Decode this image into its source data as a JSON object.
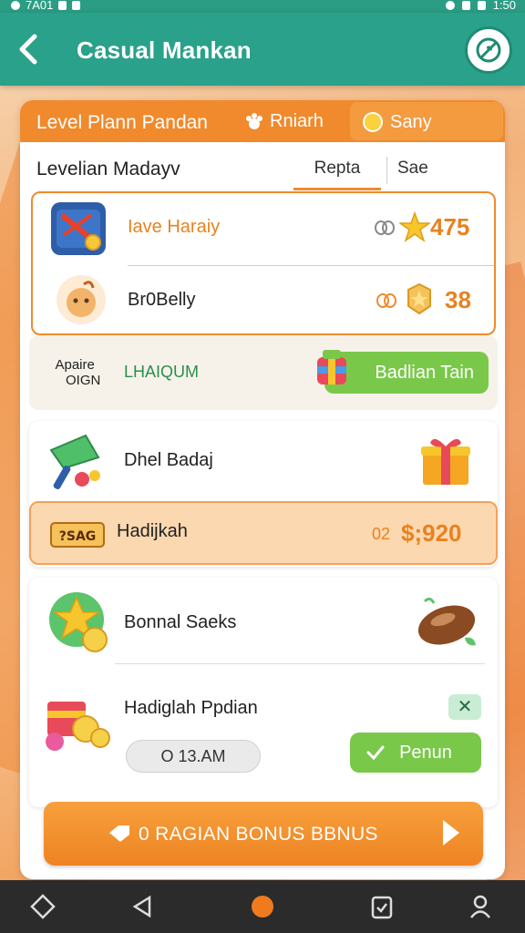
{
  "status_bar": {
    "left_text": "7A01",
    "time": "1:50"
  },
  "app_bar": {
    "title": "Casual Mankan"
  },
  "top_tabs": {
    "main_label": "Level Plann Pandan",
    "mid_label": "Rniarh",
    "right_label": "Sany"
  },
  "sub_tabs": {
    "header": "Levelian Madayv",
    "tab1": "Repta",
    "tab2": "Sae"
  },
  "levels": [
    {
      "label": "Iave Haraiy",
      "value": "475",
      "label_color": "#e8821f"
    },
    {
      "label": "Br0Belly",
      "value": "38",
      "label_color": "#222222"
    }
  ],
  "band": {
    "left_line1": "Apaire",
    "left_line2": "OIGN",
    "mid_text": "LHAIQUM",
    "button_label": "Badlian Tain"
  },
  "gifts": [
    {
      "label": "Dhel Badaj"
    },
    {
      "label": "Hadijkah",
      "value": "$;920",
      "prefix": "02"
    }
  ],
  "bonus": {
    "item1_label": "Bonnal Saeks",
    "item2_label": "Hadiglah Ppdian",
    "field_value": "O 13.AM",
    "button_label": "Penun"
  },
  "cta": {
    "label": "0 RAGIAN BONUS BBNUS"
  },
  "colors": {
    "accent_orange": "#f08a2c",
    "teal": "#2aa18a",
    "green": "#7ac84a"
  }
}
